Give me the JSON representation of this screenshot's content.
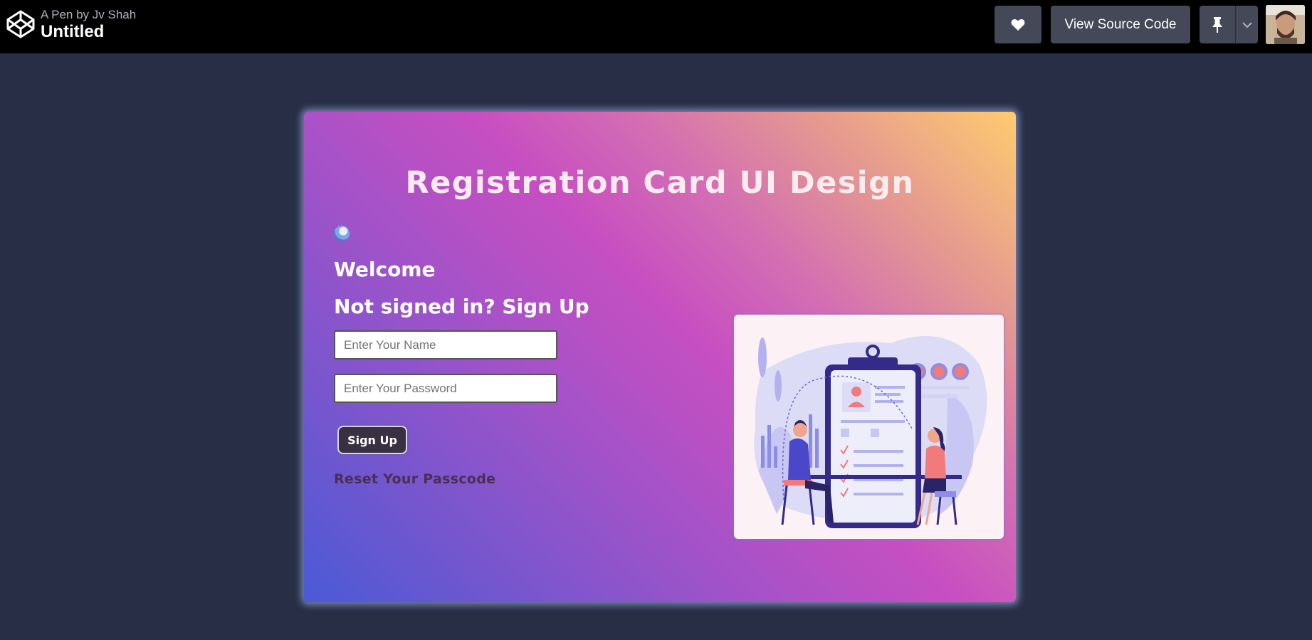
{
  "header": {
    "pen_by": "A Pen by Jv Shah",
    "title": "Untitled",
    "view_source_label": "View Source Code",
    "logo_icon": "codepen-logo-icon",
    "heart_icon": "heart-icon",
    "pin_icon": "pin-icon",
    "caret_icon": "chevron-down-icon"
  },
  "card": {
    "title": "Registration Card UI Design",
    "welcome": "Welcome",
    "signup_heading": "Not signed in? Sign Up",
    "name_placeholder": "Enter Your Name",
    "password_placeholder": "Enter Your Password",
    "signup_button": "Sign Up",
    "reset_link": "Reset Your Passcode"
  },
  "colors": {
    "page_bg": "#282e46",
    "topbar_bg": "#000000",
    "button_bg": "#444857",
    "gradient": [
      "#fecb6f",
      "#c74fc1",
      "#4a5ad6"
    ]
  }
}
